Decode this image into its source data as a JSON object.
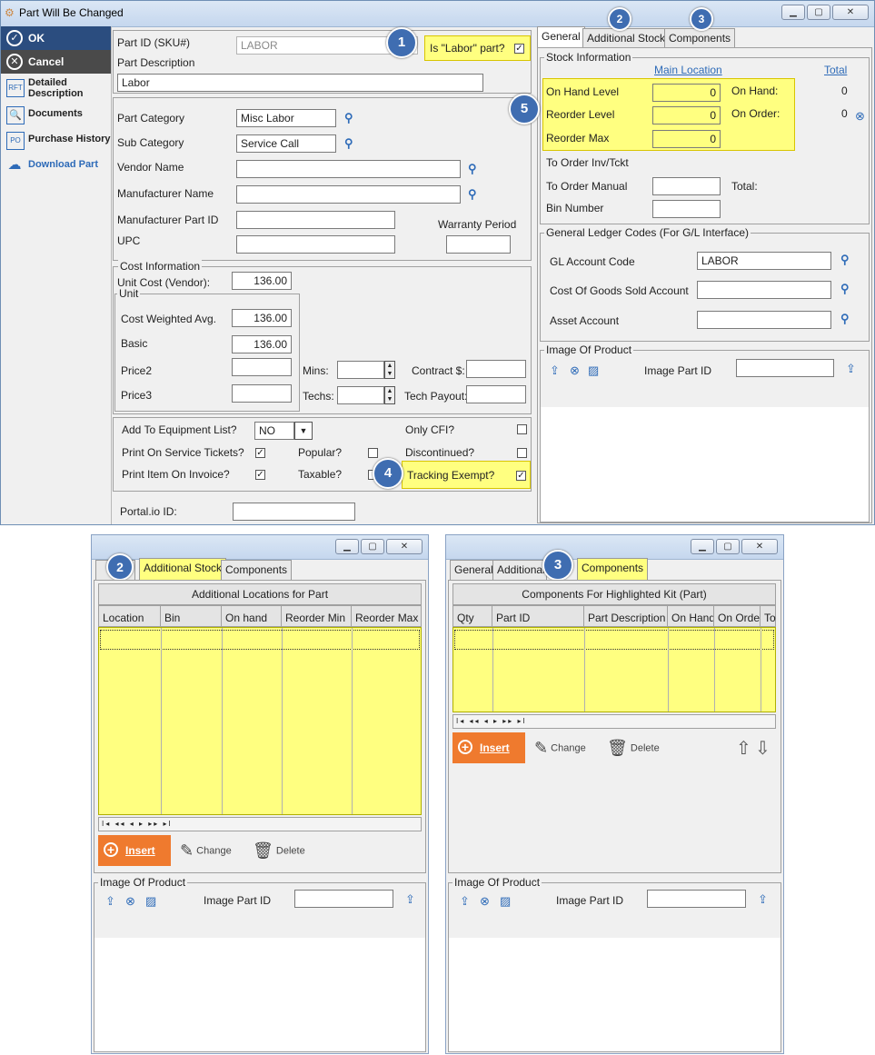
{
  "window": {
    "title": "Part Will Be Changed"
  },
  "sidebar": {
    "ok": "OK",
    "cancel": "Cancel",
    "detailed_line1": "Detailed",
    "detailed_line2": "Description",
    "documents": "Documents",
    "purchase_history": "Purchase History",
    "download": "Download Part"
  },
  "part": {
    "id_label": "Part ID (SKU#)",
    "id_value": "LABOR",
    "labor_label": "Is \"Labor\" part?",
    "desc_label": "Part Description",
    "desc_value": "Labor"
  },
  "category": {
    "part_category_label": "Part Category",
    "part_category_value": "Misc Labor",
    "sub_category_label": "Sub Category",
    "sub_category_value": "Service Call",
    "vendor_label": "Vendor Name",
    "manufacturer_label": "Manufacturer Name",
    "mfr_part_label": "Manufacturer Part ID",
    "warranty_label": "Warranty Period",
    "upc_label": "UPC"
  },
  "cost": {
    "legend": "Cost Information",
    "unit_cost_label": "Unit Cost (Vendor):",
    "unit_cost_value": "136.00",
    "unit_legend": "Unit",
    "weighted_label": "Cost Weighted Avg.",
    "weighted_value": "136.00",
    "basic_label": "Basic",
    "basic_value": "136.00",
    "price2_label": "Price2",
    "price3_label": "Price3",
    "mins_label": "Mins:",
    "techs_label": "Techs:",
    "contract_label": "Contract $:",
    "tech_payout_label": "Tech Payout:"
  },
  "flags": {
    "equipment_label": "Add To Equipment List?",
    "equipment_value": "NO",
    "only_cfi_label": "Only CFI?",
    "print_service_label": "Print On Service Tickets?",
    "popular_label": "Popular?",
    "discontinued_label": "Discontinued?",
    "print_invoice_label": "Print Item On Invoice?",
    "taxable_label": "Taxable?",
    "tracking_label": "Tracking Exempt?",
    "portal_label": "Portal.io ID:"
  },
  "tabs": {
    "general": "General",
    "additional_stock": "Additional Stock",
    "components": "Components",
    "additional_short": "Additional"
  },
  "stock": {
    "legend": "Stock Information",
    "main_location": "Main Location",
    "total": "Total",
    "on_hand_level_label": "On Hand Level",
    "on_hand_level_value": "0",
    "on_hand_label": "On Hand:",
    "on_hand_value": "0",
    "reorder_level_label": "Reorder Level",
    "reorder_level_value": "0",
    "on_order_label": "On Order:",
    "on_order_value": "0",
    "reorder_max_label": "Reorder Max",
    "reorder_max_value": "0",
    "to_order_inv_label": "To Order Inv/Tckt",
    "to_order_manual_label": "To Order Manual",
    "total_label": "Total:",
    "bin_label": "Bin Number"
  },
  "gl": {
    "legend": "General Ledger Codes (For G/L Interface)",
    "account_label": "GL Account Code",
    "account_value": "LABOR",
    "cogs_label": "Cost Of Goods Sold Account",
    "asset_label": "Asset Account"
  },
  "image": {
    "legend": "Image Of Product",
    "part_id_label": "Image Part ID"
  },
  "additional_locations": {
    "title": "Additional Locations for Part",
    "columns": [
      "Location",
      "Bin",
      "On hand",
      "Reorder Min",
      "Reorder Max"
    ]
  },
  "components_grid": {
    "title": "Components For Highlighted Kit (Part)",
    "columns": [
      "Qty",
      "Part ID",
      "Part Description",
      "On Hand",
      "On Order",
      "To"
    ]
  },
  "actions": {
    "insert": "Insert",
    "change": "Change",
    "delete": "Delete"
  },
  "badges": [
    "1",
    "2",
    "3",
    "4",
    "5"
  ],
  "colors": {
    "highlight": "#ffff80",
    "insert": "#ef7a2e",
    "ok": "#2b4d7f",
    "badge": "#3f6db1"
  }
}
